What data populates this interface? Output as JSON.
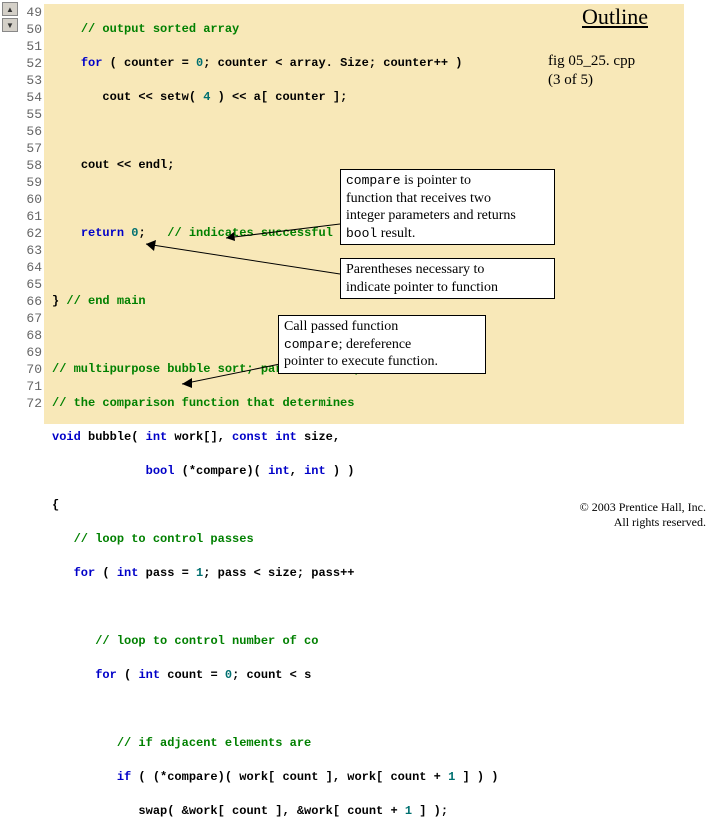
{
  "outline": {
    "title": "Outline",
    "file_line1": "fig 05_25. cpp",
    "file_line2": "(3 of 5)"
  },
  "line_start": 49,
  "line_end": 72,
  "code": {
    "l49": {
      "indent": "    ",
      "com": "// output sorted array"
    },
    "l50": {
      "indent": "    ",
      "kw1": "for",
      "t1": " ( counter = ",
      "n1": "0",
      "t2": "; counter < array. Size; counter++ )"
    },
    "l51": {
      "indent": "       ",
      "t1": "cout << setw( ",
      "n1": "4",
      "t2": " ) << a[ counter ];"
    },
    "l52": {
      "indent": "",
      "t1": ""
    },
    "l53": {
      "indent": "    ",
      "t1": "cout << endl;"
    },
    "l54": {
      "indent": "",
      "t1": ""
    },
    "l55": {
      "indent": "    ",
      "kw1": "return",
      "t1": " ",
      "n1": "0",
      "t2": ";   ",
      "com": "// indicates successful termination"
    },
    "l56": {
      "indent": "",
      "t1": ""
    },
    "l57": {
      "indent": "",
      "t1": "} ",
      "com": "// end main"
    },
    "l58": {
      "indent": "",
      "t1": ""
    },
    "l59": {
      "indent": "",
      "com": "// multipurpose bubble sort; parameter comp"
    },
    "l60": {
      "indent": "",
      "com": "// the comparison function that determines "
    },
    "l61": {
      "indent": "",
      "kw1": "void",
      "t1": " bubble( ",
      "kw2": "int",
      "t2": " work[], ",
      "kw3": "const int",
      "t3": " size,"
    },
    "l62": {
      "indent": "             ",
      "kw1": "bool",
      "t1": " (*compare)( ",
      "kw2": "int",
      "t2": ", ",
      "kw3": "int",
      "t3": " ) )"
    },
    "l63": {
      "indent": "",
      "t1": "{"
    },
    "l64": {
      "indent": "   ",
      "com": "// loop to control passes"
    },
    "l65": {
      "indent": "   ",
      "kw1": "for",
      "t1": " ( ",
      "kw2": "int",
      "t2": " pass = ",
      "n1": "1",
      "t3": "; pass < size; pass++"
    },
    "l66": {
      "indent": "",
      "t1": ""
    },
    "l67": {
      "indent": "      ",
      "com": "// loop to control number of co"
    },
    "l68": {
      "indent": "      ",
      "kw1": "for",
      "t1": " ( ",
      "kw2": "int",
      "t2": " count = ",
      "n1": "0",
      "t3": "; count < s"
    },
    "l69": {
      "indent": "",
      "t1": ""
    },
    "l70": {
      "indent": "         ",
      "com": "// if adjacent elements are "
    },
    "l71": {
      "indent": "         ",
      "kw1": "if",
      "t1": " ( (*compare)( work[ count ], work[ count + ",
      "n1": "1",
      "t2": " ] ) )"
    },
    "l72": {
      "indent": "            ",
      "t1": "swap( &work[ count ], &work[ count + ",
      "n1": "1",
      "t2": " ] );"
    }
  },
  "callouts": {
    "c1": {
      "p1a": "compare",
      "p1b": " is pointer to",
      "p2": "function that receives two",
      "p3": "integer parameters and returns",
      "p4a": "bool",
      "p4b": " result."
    },
    "c2": {
      "p1": "Parentheses necessary to",
      "p2": "indicate pointer to function"
    },
    "c3": {
      "p1": "Call passed function",
      "p2a": "compare",
      "p2b": "; dereference",
      "p3": "pointer to execute function."
    }
  },
  "footer": {
    "line1": "© 2003 Prentice Hall, Inc.",
    "line2": "All rights reserved."
  }
}
